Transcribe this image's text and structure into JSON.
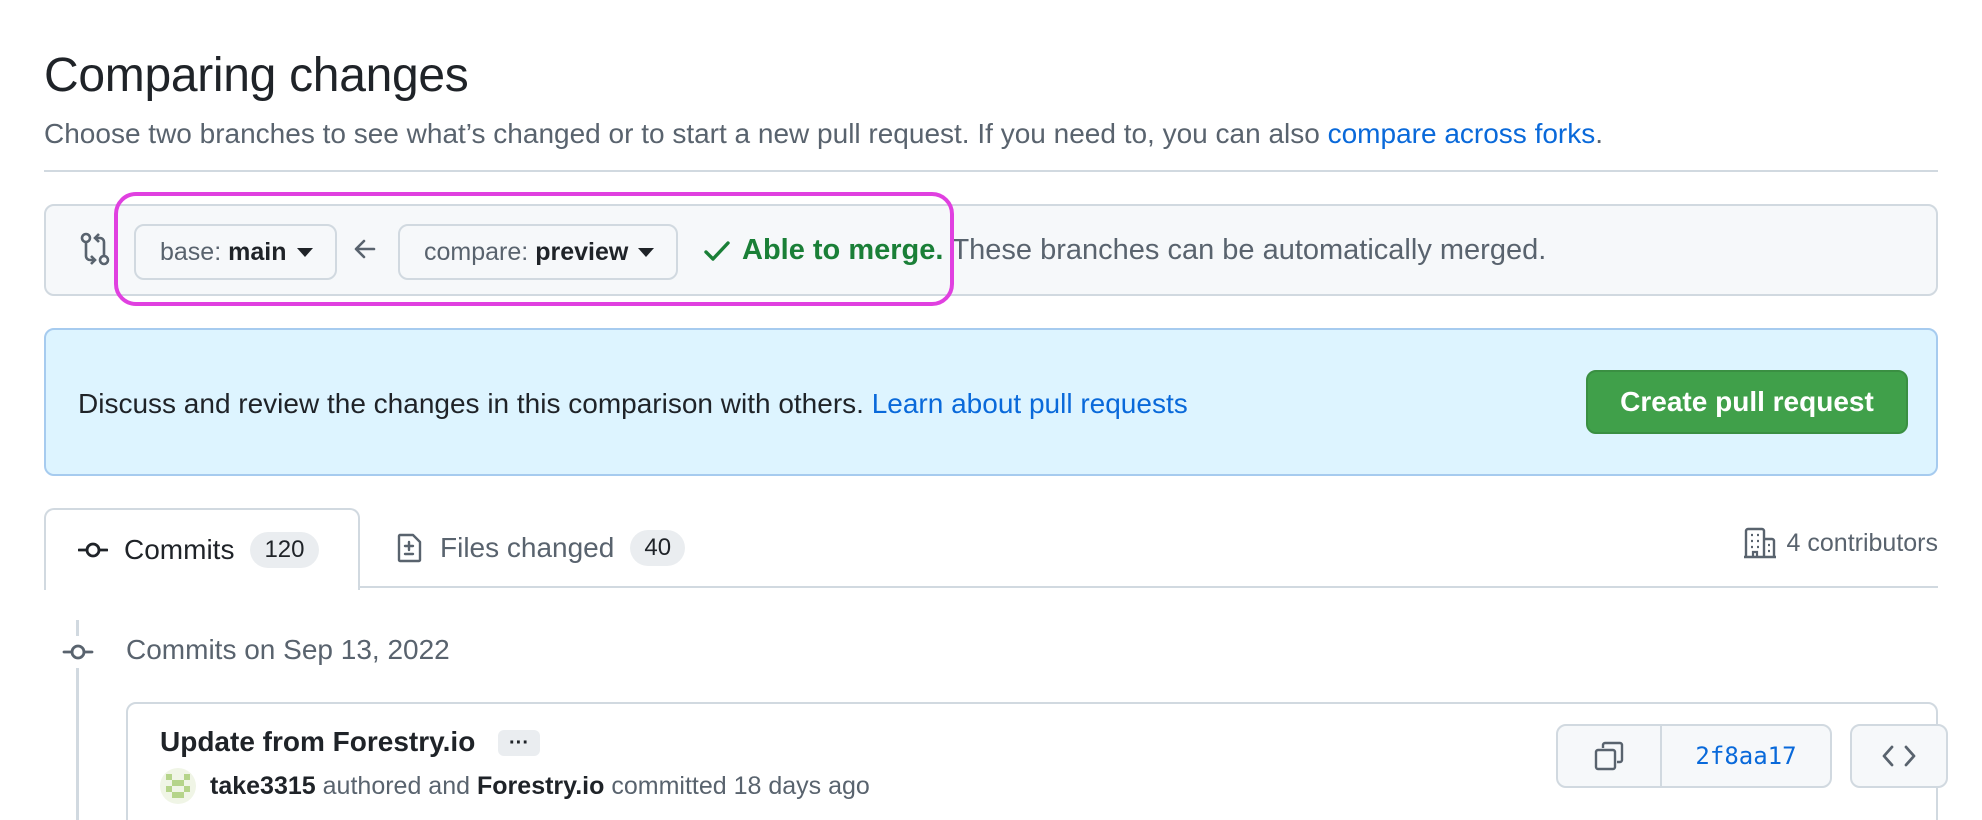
{
  "header": {
    "title": "Comparing changes",
    "subtitle": "Choose two branches to see what’s changed or to start a new pull request. If you need to, you can also ",
    "subtitle_link": "compare across forks",
    "subtitle_end": "."
  },
  "range_editor": {
    "base_prefix": "base:",
    "base_branch": "main",
    "compare_prefix": "compare:",
    "compare_branch": "preview",
    "merge_ok": "Able to merge.",
    "merge_desc": "These branches can be automatically merged."
  },
  "banner": {
    "text": "Discuss and review the changes in this comparison with others. ",
    "link": "Learn about pull requests",
    "button": "Create pull request"
  },
  "tabs": [
    {
      "label": "Commits",
      "count": "120",
      "active": true
    },
    {
      "label": "Files changed",
      "count": "40",
      "active": false
    }
  ],
  "contributors": "4 contributors",
  "commits": {
    "date_heading": "Commits on Sep 13, 2022",
    "items": [
      {
        "title": "Update from Forestry.io",
        "ellipsis": "···",
        "author": "take3315",
        "authored_text": "authored and",
        "committer": "Forestry.io",
        "committed_text": "committed 18 days ago",
        "sha": "2f8aa17"
      }
    ]
  },
  "colors": {
    "link": "#0969da",
    "success": "#1a7f37",
    "primary_button": "#40a04a",
    "highlight": "#e040e0",
    "banner_bg": "#ddf4ff"
  },
  "icons": [
    "compare-icon",
    "arrow-left-icon",
    "check-icon",
    "commit-icon",
    "file-diff-icon",
    "organization-icon",
    "copy-icon",
    "code-icon"
  ]
}
